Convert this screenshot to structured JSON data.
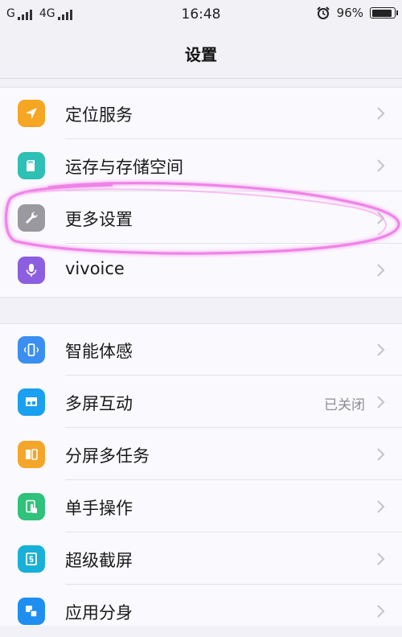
{
  "status_bar": {
    "carrier1": "G",
    "carrier2": "4G",
    "time": "16:48",
    "battery_percent": "96%",
    "battery_level": 0.96
  },
  "header": {
    "title": "设置"
  },
  "colors": {
    "location": "#f5a623",
    "storage": "#2fc0b5",
    "more": "#9a99a0",
    "vivoice": "#8b5fe0",
    "smart": "#3a8ff0",
    "multiscreen": "#1aa0f0",
    "split": "#f4a62a",
    "onehand": "#2fc27a",
    "screenshot": "#17b0d8",
    "appclone": "#1e8ff0",
    "annotation": "#f07be6"
  },
  "settings": {
    "group1": [
      {
        "label": "定位服务",
        "icon": "location-arrow-icon"
      },
      {
        "label": "运存与存储空间",
        "icon": "sd-card-icon"
      },
      {
        "label": "更多设置",
        "icon": "wrench-icon"
      },
      {
        "label": "vivoice",
        "icon": "microphone-icon"
      }
    ],
    "group2": [
      {
        "label": "智能体感",
        "icon": "phone-motion-icon"
      },
      {
        "label": "多屏互动",
        "icon": "cast-screen-icon",
        "value": "已关闭"
      },
      {
        "label": "分屏多任务",
        "icon": "split-screen-icon"
      },
      {
        "label": "单手操作",
        "icon": "one-hand-icon"
      },
      {
        "label": "超级截屏",
        "icon": "screenshot-icon"
      },
      {
        "label": "应用分身",
        "icon": "app-clone-icon"
      }
    ]
  }
}
